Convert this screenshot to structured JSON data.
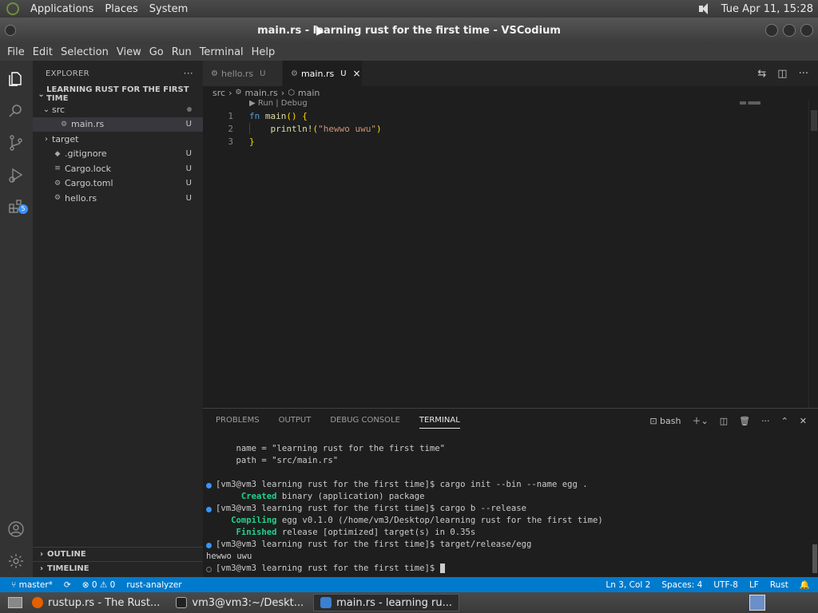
{
  "gnome_panel": {
    "menus": [
      "Applications",
      "Places",
      "System"
    ],
    "clock": "Tue Apr 11, 15:28"
  },
  "window": {
    "title": "main.rs - learning rust for the first time - VSCodium"
  },
  "menubar": [
    "File",
    "Edit",
    "Selection",
    "View",
    "Go",
    "Run",
    "Terminal",
    "Help"
  ],
  "activitybar": {
    "scm_badge": "5"
  },
  "sidebar": {
    "title": "EXPLORER",
    "more": "···",
    "folder": "LEARNING RUST FOR THE FIRST TIME",
    "tree": [
      {
        "label": "src",
        "chev": "⌄",
        "icon": "",
        "status": ""
      },
      {
        "label": "main.rs",
        "chev": "",
        "icon": "⚙",
        "status": "U"
      },
      {
        "label": "target",
        "chev": "›",
        "icon": "",
        "status": ""
      },
      {
        "label": ".gitignore",
        "chev": "",
        "icon": "◆",
        "status": "U"
      },
      {
        "label": "Cargo.lock",
        "chev": "",
        "icon": "≡",
        "status": "U"
      },
      {
        "label": "Cargo.toml",
        "chev": "",
        "icon": "⚙",
        "status": "U"
      },
      {
        "label": "hello.rs",
        "chev": "",
        "icon": "⚙",
        "status": "U"
      }
    ],
    "outline": "OUTLINE",
    "timeline": "TIMELINE"
  },
  "tabs": [
    {
      "label": "hello.rs",
      "mark": "U"
    },
    {
      "label": "main.rs",
      "mark": "U",
      "close": "×"
    }
  ],
  "breadcrumb": {
    "folder": "src",
    "file": "main.rs",
    "symbol": "main"
  },
  "editor": {
    "codelens": "Run | Debug",
    "lines": [
      {
        "num": "1",
        "text": "fn main() {"
      },
      {
        "num": "2",
        "text": "    println!(\"hewwo uwu\")"
      },
      {
        "num": "3",
        "text": "}"
      }
    ]
  },
  "panel": {
    "tabs": [
      "PROBLEMS",
      "OUTPUT",
      "DEBUG CONSOLE",
      "TERMINAL"
    ],
    "shell": "bash",
    "terminal": [
      "    name = \"learning rust for the first time\"",
      "    path = \"src/main.rs\"",
      "",
      "[vm3@vm3 learning rust for the first time]$ cargo init --bin --name egg .",
      "     Created binary (application) package",
      "[vm3@vm3 learning rust for the first time]$ cargo b --release",
      "   Compiling egg v0.1.0 (/home/vm3/Desktop/learning rust for the first time)",
      "    Finished release [optimized] target(s) in 0.35s",
      "[vm3@vm3 learning rust for the first time]$ target/release/egg",
      "hewwo uwu",
      "[vm3@vm3 learning rust for the first time]$ "
    ],
    "terminal_parts": {
      "created_word": "Created",
      "created_rest": " binary (application) package",
      "compiling_word": "Compiling",
      "compiling_rest": " egg v0.1.0 (/home/vm3/Desktop/learning rust for the first time)",
      "finished_word": "Finished",
      "finished_rest": " release [optimized] target(s) in 0.35s"
    }
  },
  "statusbar": {
    "branch": "master*",
    "problems": "⊗ 0 ⚠ 0",
    "extension": "rust-analyzer",
    "position": "Ln 3, Col 2",
    "spaces": "Spaces: 4",
    "encoding": "UTF-8",
    "eol": "LF",
    "language": "Rust"
  },
  "taskbar": [
    {
      "label": "rustup.rs - The Rust...",
      "icon_color": "#e66000"
    },
    {
      "label": "vm3@vm3:~/Deskt...",
      "icon_color": "#222222"
    },
    {
      "label": "main.rs - learning ru...",
      "icon_color": "#3b7fd0"
    }
  ]
}
